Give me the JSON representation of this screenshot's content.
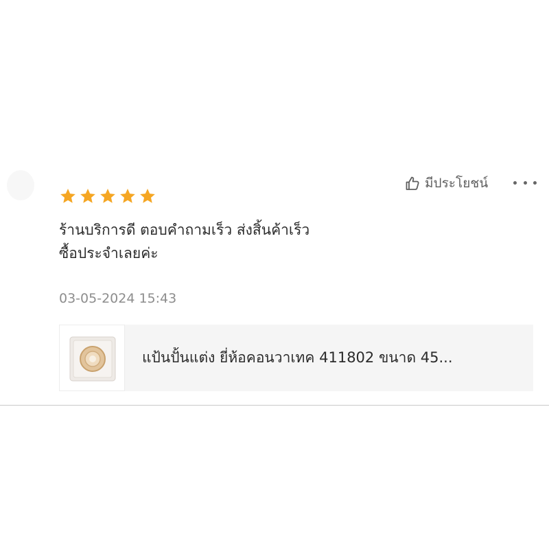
{
  "review": {
    "rating": 5,
    "max_rating": 5,
    "text_lines": [
      "ร้านบริการดี ตอบคำถามเร็ว ส่งสิ้นค้าเร็ว",
      "ซื้อประจำเลยค่ะ"
    ],
    "timestamp": "03-05-2024 15:43"
  },
  "actions": {
    "helpful_label": "มีประโยชน์",
    "helpful_icon": "thumbs-up-icon",
    "more_icon": "more-options-icon"
  },
  "product": {
    "name": "แป้นปั้นแต่ง ยี่ห้อคอนวาเทค 411802 ขนาด 45...",
    "thumbnail_icon": "ostomy-wafer-product-image"
  },
  "colors": {
    "star": "#f5a623",
    "text": "#2b2b2b",
    "muted": "#8d8d8d",
    "card_bg": "#f5f5f5",
    "divider": "#c9c9c9"
  }
}
